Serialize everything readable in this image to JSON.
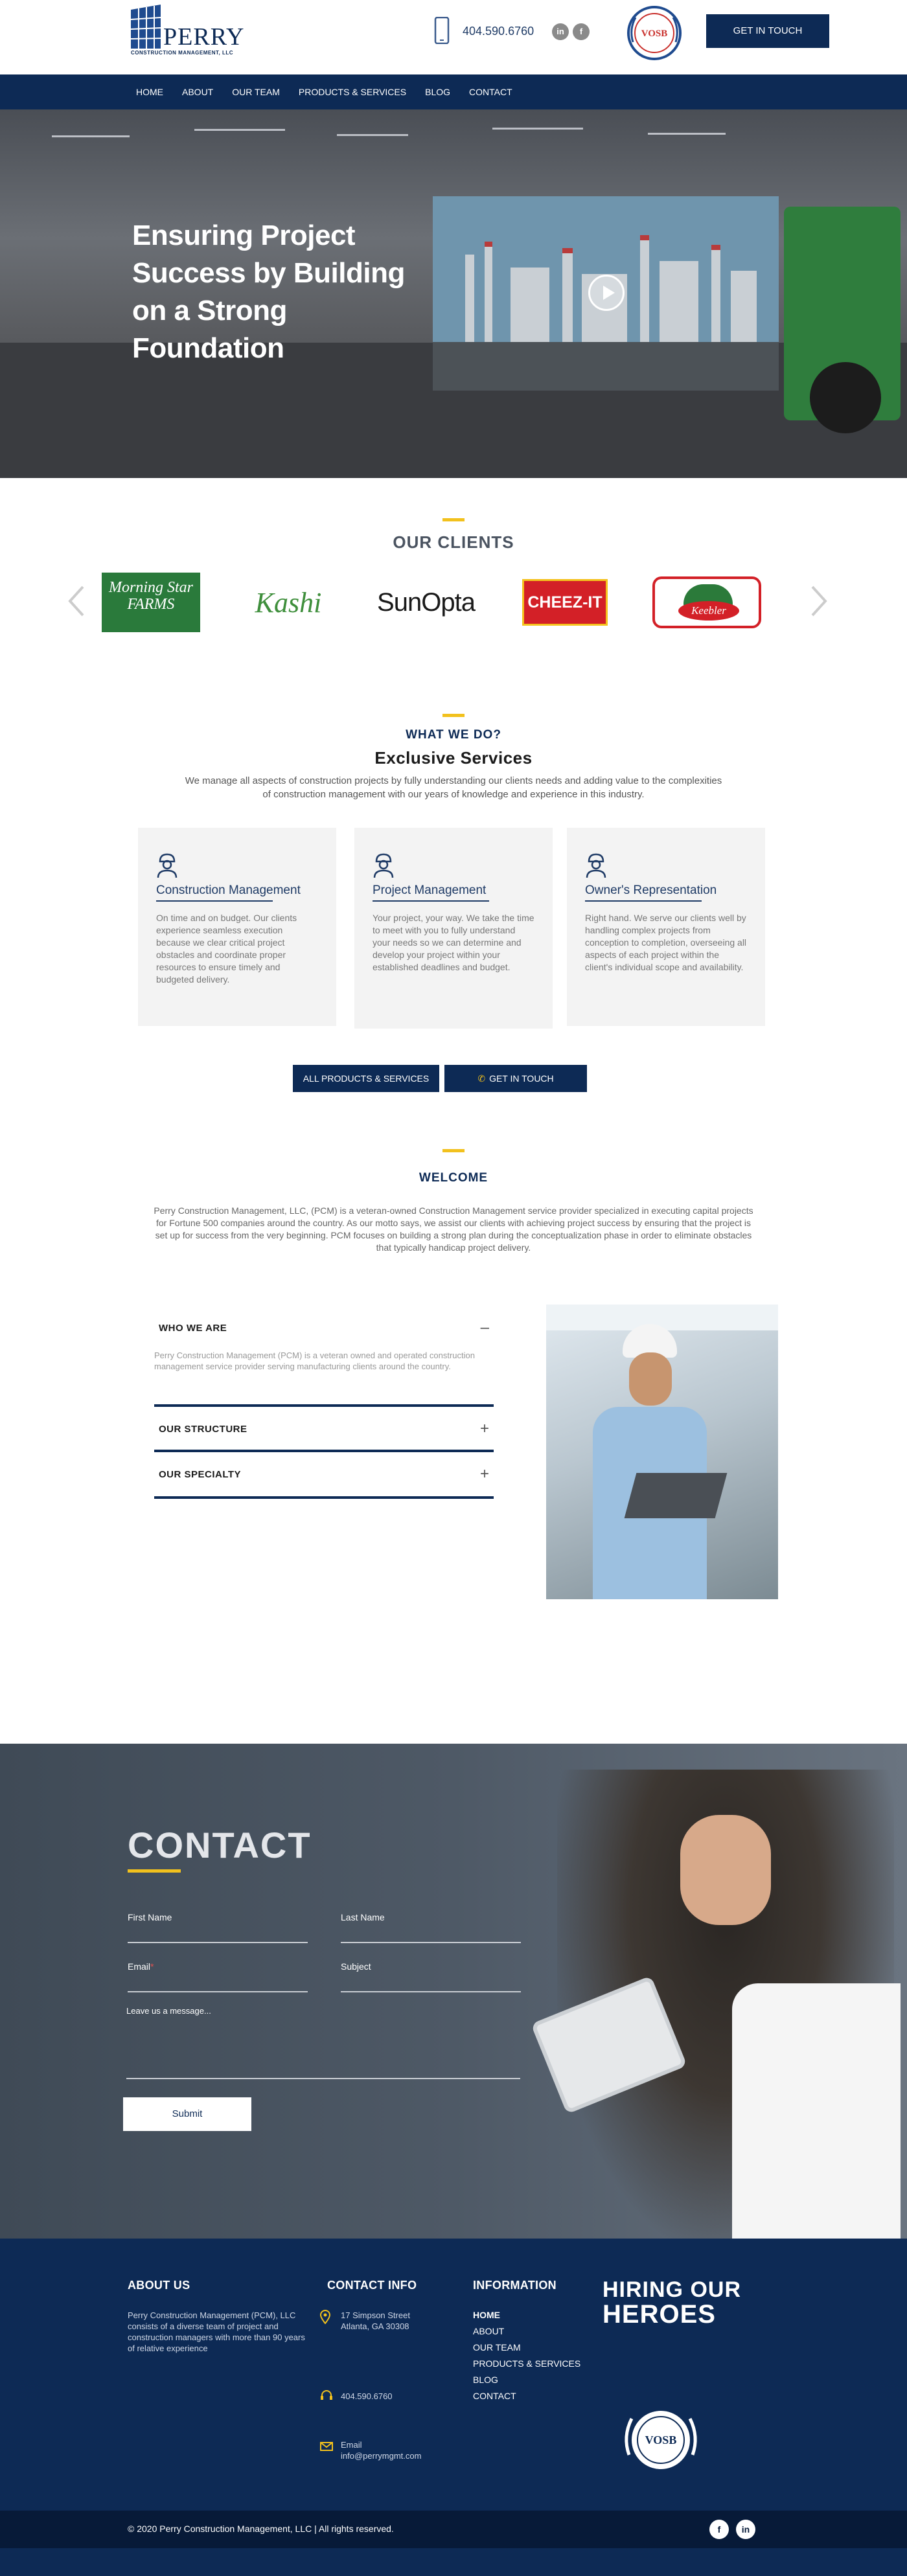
{
  "header": {
    "brand": "PERRY",
    "brand_sub": "CONSTRUCTION MANAGEMENT, LLC",
    "phone": "404.590.6760",
    "social": [
      "linkedin-icon",
      "facebook-icon"
    ],
    "badge": "VOSB",
    "cta": "GET IN TOUCH"
  },
  "nav": [
    "HOME",
    "ABOUT",
    "OUR TEAM",
    "PRODUCTS & SERVICES",
    "BLOG",
    "CONTACT"
  ],
  "hero": {
    "title": "Ensuring Project Success by Building on a Strong Foundation"
  },
  "clients": {
    "title": "OUR CLIENTS",
    "logos": [
      "Morning Star FARMS",
      "Kashi",
      "SunOpta",
      "CHEEZ-IT",
      "Keebler"
    ]
  },
  "services": {
    "kicker": "WHAT WE DO?",
    "title": "Exclusive Services",
    "description": "We manage all aspects of construction projects by fully understanding our clients needs and adding value to the complexities of construction management with our years of knowledge and experience in this industry.",
    "cards": [
      {
        "title": "Construction Management",
        "text": "On time and on budget.  Our clients experience seamless execution because we clear critical project obstacles and coordinate proper resources to ensure timely and budgeted delivery."
      },
      {
        "title": "Project Management",
        "text": "Your project, your way.  We take the time to meet with you to fully understand your needs so we can determine and develop your project within your established deadlines and budget."
      },
      {
        "title": "Owner's Representation",
        "text": "Right hand.  We serve our clients well by handling complex projects from conception to completion, overseeing all aspects of each project within the client's individual scope and availability."
      }
    ],
    "btn_all": "ALL PRODUCTS & SERVICES",
    "btn_touch": "GET IN TOUCH"
  },
  "welcome": {
    "title": "WELCOME",
    "text": "Perry Construction Management, LLC, (PCM) is a veteran-owned Construction Management service provider specialized in executing capital projects for Fortune 500 companies around the country. As our motto says, we assist our clients with achieving project success by ensuring that the project is set up for success from the very beginning. PCM focuses on building a strong plan during the conceptualization phase in order to eliminate obstacles that typically handicap project delivery."
  },
  "accordion": [
    {
      "title": "WHO WE ARE",
      "symbol": "–",
      "body": "Perry Construction Management (PCM) is a veteran owned and operated construction management service provider serving manufacturing clients around the country."
    },
    {
      "title": "OUR STRUCTURE",
      "symbol": "+"
    },
    {
      "title": "OUR SPECIALTY",
      "symbol": "+"
    }
  ],
  "contact": {
    "title": "CONTACT",
    "first_name": "First Name",
    "last_name": "Last Name",
    "email": "Email",
    "email_required": "*",
    "subject": "Subject",
    "message": "Leave us a message...",
    "submit": "Submit"
  },
  "footer": {
    "about_title": "ABOUT US",
    "about_text": "Perry Construction Management (PCM), LLC consists of a diverse team of project and construction managers with more than 90 years of relative experience",
    "contact_title": "CONTACT INFO",
    "address_1": "17 Simpson Street",
    "address_2": "Atlanta, GA 30308",
    "phone": "404.590.6760",
    "email_label": "Email",
    "email": "info@perrymgmt.com",
    "info_title": "INFORMATION",
    "links": [
      "HOME",
      "ABOUT",
      "OUR TEAM",
      "PRODUCTS & SERVICES",
      "BLOG",
      "CONTACT"
    ],
    "heroes_1": "HIRING OUR",
    "heroes_2": "HEROES",
    "badge": "VOSB",
    "copyright": "© 2020 Perry Construction Management, LLC  |  All rights reserved."
  },
  "colors": {
    "navy": "#0d2a55",
    "accent": "#f2c11d"
  }
}
